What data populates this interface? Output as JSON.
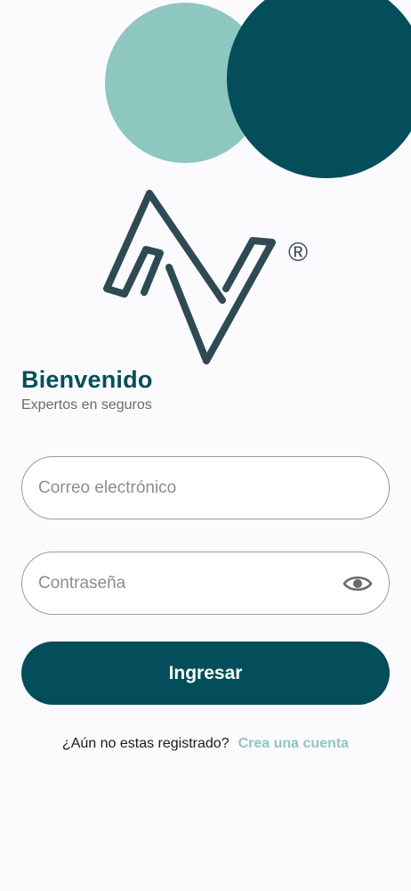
{
  "colors": {
    "primary": "#034e5a",
    "accent": "#8dc7c0",
    "background": "#fbfbfd"
  },
  "logo": {
    "registered_mark": "®"
  },
  "header": {
    "title": "Bienvenido",
    "subtitle": "Expertos en seguros"
  },
  "form": {
    "email": {
      "placeholder": "Correo electrónico",
      "value": ""
    },
    "password": {
      "placeholder": "Contraseña",
      "value": "",
      "toggle_icon": "eye-icon"
    },
    "submit_label": "Ingresar"
  },
  "signup": {
    "question": "¿Aún no estas registrado?",
    "link_label": "Crea una cuenta"
  }
}
